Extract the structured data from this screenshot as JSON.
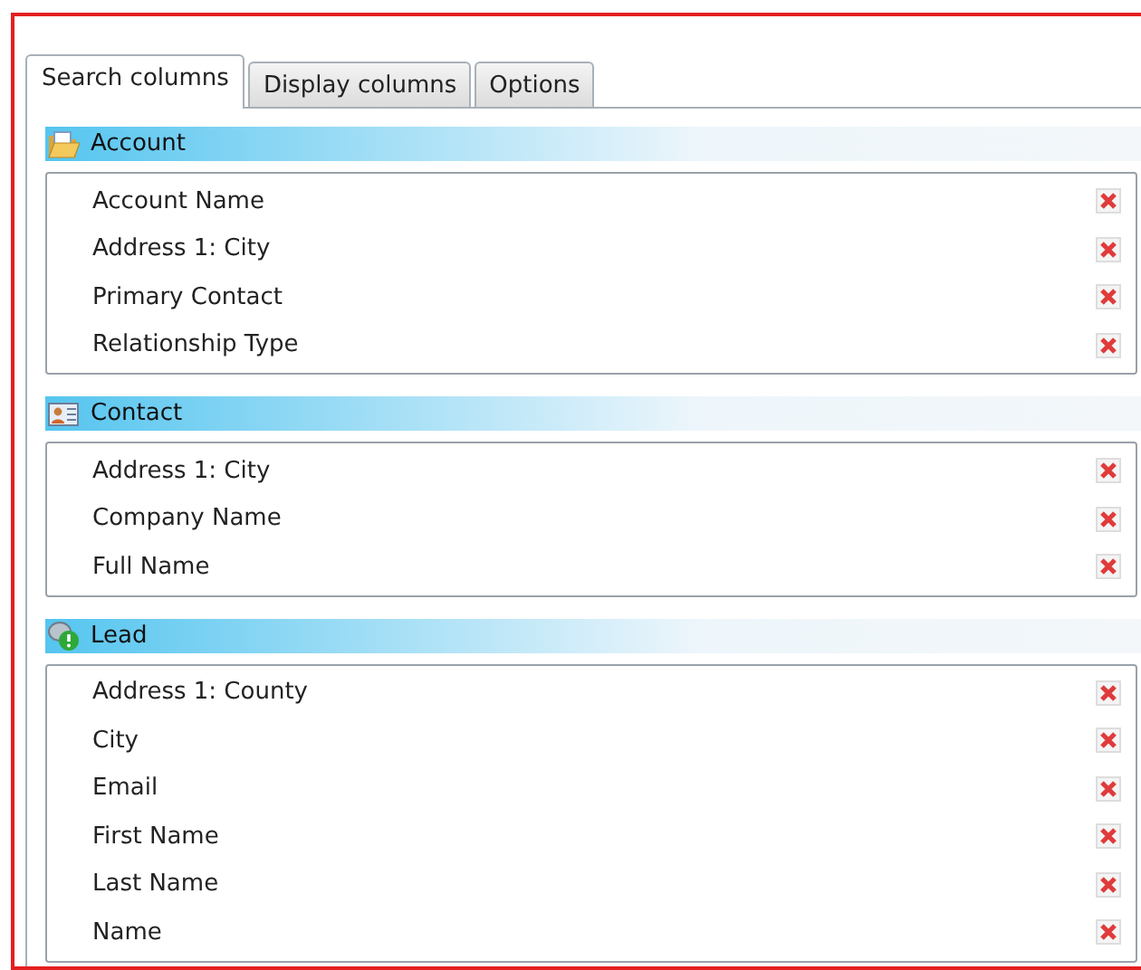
{
  "tabs": [
    {
      "label": "Search columns",
      "selected": true
    },
    {
      "label": "Display columns",
      "selected": false
    },
    {
      "label": "Options",
      "selected": false
    }
  ],
  "sections": [
    {
      "title": "Account",
      "kind": "account",
      "rows": [
        "Account Name",
        "Address 1: City",
        "Primary Contact",
        "Relationship Type"
      ]
    },
    {
      "title": "Contact",
      "kind": "contact",
      "rows": [
        "Address 1: City",
        "Company Name",
        "Full Name"
      ]
    },
    {
      "title": "Lead",
      "kind": "lead",
      "rows": [
        "Address 1: County",
        "City",
        "Email",
        "First Name",
        "Last Name",
        "Name"
      ]
    }
  ]
}
